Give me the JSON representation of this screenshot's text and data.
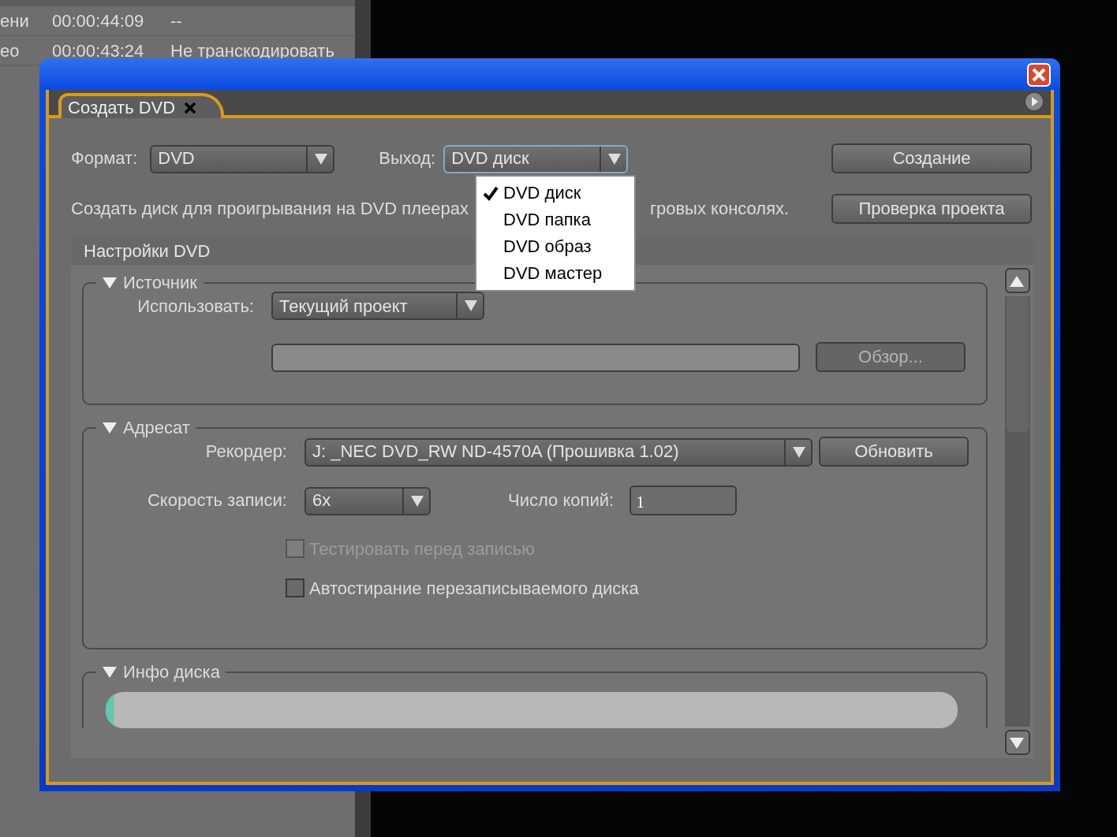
{
  "background_table": {
    "rows": [
      {
        "column_1": "ени",
        "column_2": "00:00:44:09",
        "column_3": "--"
      },
      {
        "column_1": "ео",
        "column_2": "00:00:43:24",
        "column_3": "Не транскодировать"
      }
    ]
  },
  "dialog": {
    "tab": {
      "label": "Создать DVD"
    },
    "format": {
      "label": "Формат:",
      "value": "DVD"
    },
    "output": {
      "label": "Выход:",
      "value": "DVD диск",
      "expanded": true,
      "options": [
        {
          "label": "DVD диск",
          "selected": true
        },
        {
          "label": "DVD папка",
          "selected": false
        },
        {
          "label": "DVD образ",
          "selected": false
        },
        {
          "label": "DVD мастер",
          "selected": false
        }
      ]
    },
    "buttons": [
      {
        "label": "Создание",
        "disabled": false
      },
      {
        "label": "Проверка проекта",
        "disabled": false
      }
    ],
    "description_start": "Создать диск для проигрывания на DVD плеерах",
    "description_end": "гровых консолях.",
    "settings": {
      "title": "Настройки DVD",
      "source": {
        "title": "Источник",
        "expanded": true,
        "use_label": "Использовать:",
        "use_value": "Текущий проект",
        "browse_button": {
          "label": "Обзор...",
          "disabled": true
        }
      },
      "destination": {
        "title": "Адресат",
        "expanded": true,
        "recorder_label": "Рекордер:",
        "recorder_value": "J: _NEC DVD_RW ND-4570A (Прошивка 1.02)",
        "refresh_button": {
          "label": "Обновить",
          "disabled": false
        },
        "speed_label": "Скорость записи:",
        "speed_value": "6x",
        "copies_label": "Число копий:",
        "copies_value": "1",
        "checkboxes": [
          {
            "label": "Тестировать перед записью",
            "checked": false,
            "disabled": true
          },
          {
            "label": "Автостирание перезаписываемого диска",
            "checked": false,
            "disabled": false
          }
        ]
      },
      "disc_info": {
        "title": "Инфо диска",
        "expanded": true,
        "level": 0.01
      }
    }
  }
}
